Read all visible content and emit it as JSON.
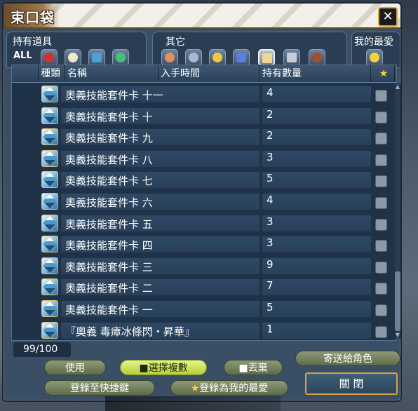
{
  "window": {
    "title": "束口袋",
    "close_glyph": "✕"
  },
  "categories": {
    "owned": {
      "label": "持有道具",
      "all": "ALL"
    },
    "other": {
      "label": "其它"
    },
    "favorites": {
      "label": "我的最愛"
    }
  },
  "table": {
    "headers": {
      "type": "種類",
      "name": "名稱",
      "acquired": "入手時間",
      "quantity": "持有數量",
      "favorite_icon": "star-icon"
    },
    "rows": [
      {
        "name": "奧義技能套件卡 十一",
        "quantity": "4"
      },
      {
        "name": "奧義技能套件卡 十",
        "quantity": "2"
      },
      {
        "name": "奧義技能套件卡 九",
        "quantity": "2"
      },
      {
        "name": "奧義技能套件卡 八",
        "quantity": "3"
      },
      {
        "name": "奧義技能套件卡 七",
        "quantity": "5"
      },
      {
        "name": "奧義技能套件卡 六",
        "quantity": "4"
      },
      {
        "name": "奧義技能套件卡 五",
        "quantity": "3"
      },
      {
        "name": "奧義技能套件卡 四",
        "quantity": "3"
      },
      {
        "name": "奧義技能套件卡 三",
        "quantity": "9"
      },
      {
        "name": "奧義技能套件卡 二",
        "quantity": "7"
      },
      {
        "name": "奧義技能套件卡 一",
        "quantity": "5"
      },
      {
        "name": "『奧義 毒瘴冰條閃・昇華』",
        "quantity": "1"
      }
    ]
  },
  "capacity": "99/100",
  "buttons": {
    "use": "使用",
    "multi_select": "選擇複數",
    "discard": "丟棄",
    "send_to_character": "寄送給角色",
    "register_shortcut": "登錄至快捷鍵",
    "register_favorite": "登錄為我的最愛",
    "close": "關 閉"
  },
  "colors": {
    "accent_gold": "#d9a240",
    "selected_button": "#cfe35a",
    "panel": "#203248"
  }
}
